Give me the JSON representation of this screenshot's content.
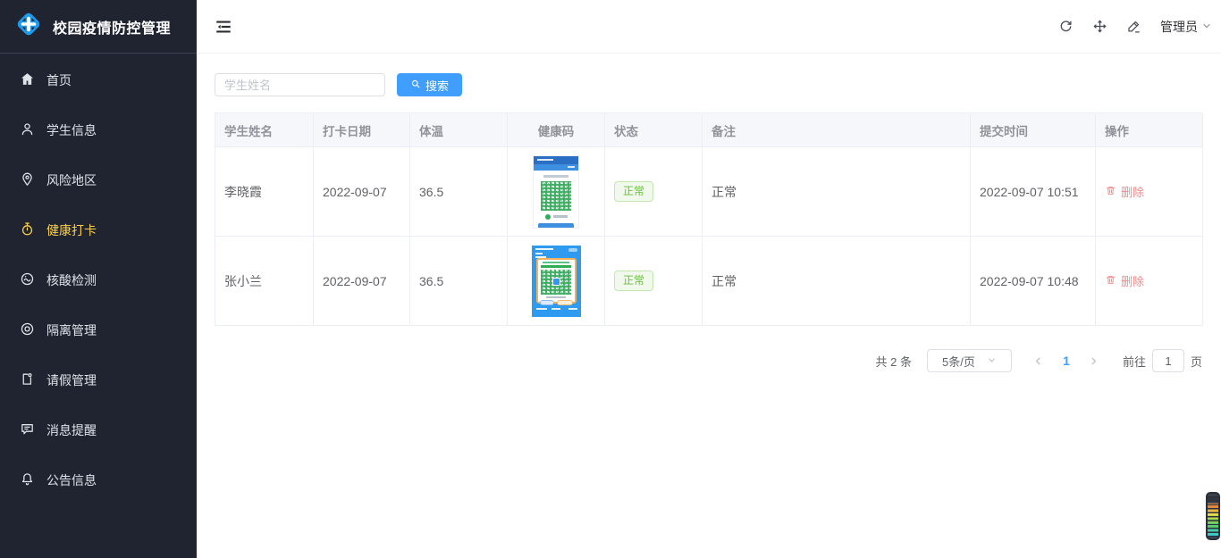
{
  "app": {
    "title": "校园疫情防控管理",
    "logo_icon": "medical-cross-diamond-icon"
  },
  "sidebar": {
    "items": [
      {
        "label": "首页",
        "icon": "home-icon",
        "active": false
      },
      {
        "label": "学生信息",
        "icon": "user-icon",
        "active": false
      },
      {
        "label": "风险地区",
        "icon": "location-pin-icon",
        "active": false
      },
      {
        "label": "健康打卡",
        "icon": "stopwatch-icon",
        "active": true
      },
      {
        "label": "核酸检测",
        "icon": "nucleic-test-icon",
        "active": false
      },
      {
        "label": "隔离管理",
        "icon": "isolation-icon",
        "active": false
      },
      {
        "label": "请假管理",
        "icon": "leave-form-icon",
        "active": false
      },
      {
        "label": "消息提醒",
        "icon": "message-icon",
        "active": false
      },
      {
        "label": "公告信息",
        "icon": "bell-icon",
        "active": false
      }
    ]
  },
  "topbar": {
    "icons": [
      "refresh-icon",
      "move-icon",
      "edit-pen-icon"
    ],
    "user_label": "管理员"
  },
  "toolbar": {
    "search_placeholder": "学生姓名",
    "search_label": "搜索"
  },
  "table": {
    "columns": [
      "学生姓名",
      "打卡日期",
      "体温",
      "健康码",
      "状态",
      "备注",
      "提交时间",
      "操作"
    ],
    "rows": [
      {
        "name": "李晓霞",
        "date": "2022-09-07",
        "temperature": "36.5",
        "health_code": "green-qr-health-code",
        "status": "正常",
        "remark": "正常",
        "submitted": "2022-09-07 10:51",
        "action": "删除"
      },
      {
        "name": "张小兰",
        "date": "2022-09-07",
        "temperature": "36.5",
        "health_code": "green-qr-health-code",
        "status": "正常",
        "remark": "正常",
        "submitted": "2022-09-07 10:48",
        "action": "删除"
      }
    ]
  },
  "pagination": {
    "total": "共 2 条",
    "page_size": "5条/页",
    "page": "1",
    "goto_label": "前往",
    "goto_value": "1",
    "unit_label": "页"
  },
  "colors": {
    "accent": "#409eff",
    "sidebar_bg": "#1f2430",
    "active_item": "#ffd04b",
    "success": "#67c23a",
    "danger": "#f78989"
  }
}
